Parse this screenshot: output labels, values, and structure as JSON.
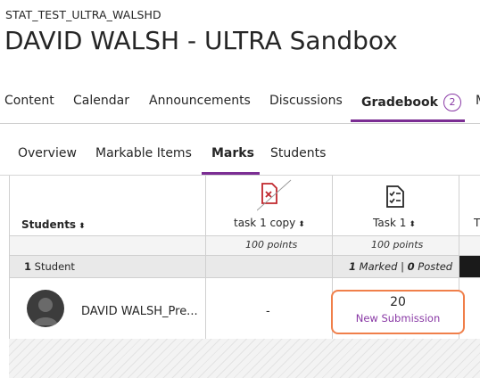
{
  "course": {
    "id": "STAT_TEST_ULTRA_WALSHD",
    "title": "DAVID WALSH - ULTRA Sandbox"
  },
  "nav": {
    "tabs": [
      {
        "label": "Content"
      },
      {
        "label": "Calendar"
      },
      {
        "label": "Announcements"
      },
      {
        "label": "Discussions"
      },
      {
        "label": "Gradebook",
        "badge": "2",
        "active": true
      },
      {
        "label": "M"
      }
    ]
  },
  "subnav": {
    "tabs": [
      {
        "label": "Overview"
      },
      {
        "label": "Markable Items"
      },
      {
        "label": "Marks",
        "active": true
      },
      {
        "label": "Students"
      }
    ]
  },
  "grid": {
    "students_header": "Students",
    "columns": [
      {
        "title": "task 1 copy",
        "points": "100 points",
        "icon": "hidden-document-icon"
      },
      {
        "title": "Task 1",
        "points": "100 points",
        "icon": "checklist-document-icon"
      },
      {
        "title": "T"
      }
    ],
    "summary": {
      "student_count": "1",
      "student_label": "Student",
      "marked_count": "1",
      "marked_label": "Marked",
      "separator": "|",
      "posted_count": "0",
      "posted_label": "Posted"
    },
    "rows": [
      {
        "student_name": "DAVID WALSH_Pre...",
        "task1_copy": "-",
        "task1_grade": "20",
        "task1_status": "New Submission"
      }
    ]
  },
  "colors": {
    "accent": "#7b2d93",
    "highlight_border": "#f07f4a",
    "hidden_icon": "#c0272d"
  }
}
